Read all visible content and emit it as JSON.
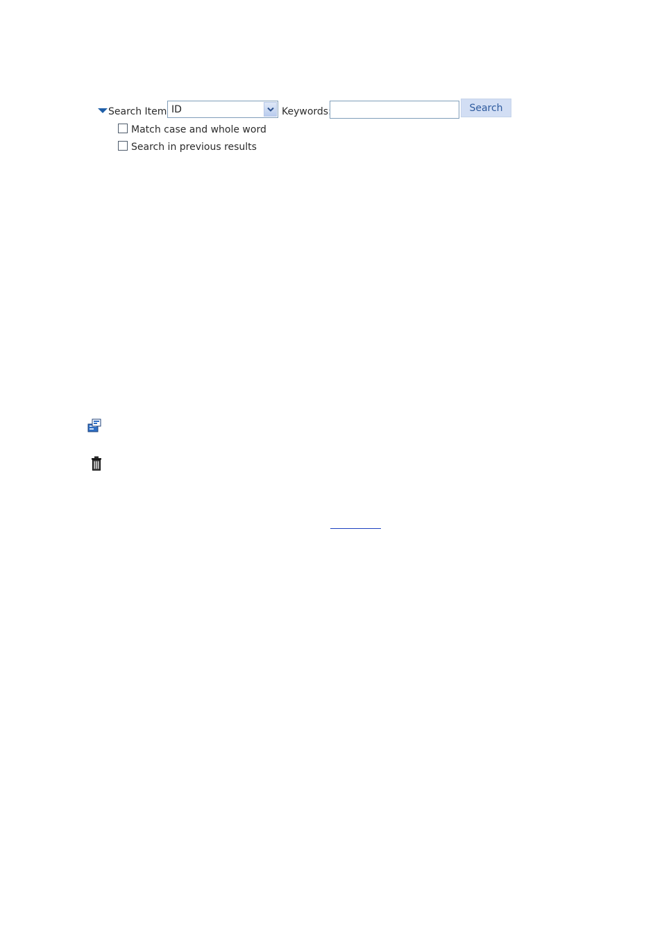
{
  "search": {
    "item_label": "Search Item:",
    "item_selected": "ID",
    "keywords_label": "Keywords:",
    "keywords_value": "",
    "button_label": "Search",
    "options": [
      {
        "label": "Match case and whole word",
        "checked": false
      },
      {
        "label": "Search in previous results",
        "checked": false
      }
    ]
  },
  "icons": {
    "properties": "properties-icon",
    "delete": "trash-icon"
  },
  "colors": {
    "accent": "#1f5fa8",
    "button_bg": "#d2def4",
    "button_text": "#2d5a9e",
    "input_border": "#7f9db9",
    "link": "#1a3fbf"
  }
}
